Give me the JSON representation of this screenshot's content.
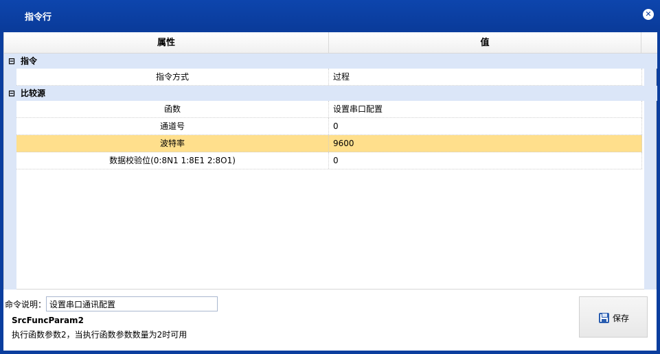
{
  "window": {
    "title": "指令行"
  },
  "grid": {
    "columns": [
      "属性",
      "值"
    ],
    "categories": [
      {
        "toggle": "⊟",
        "name": "指令",
        "rows": [
          {
            "name": "指令方式",
            "value": "过程",
            "selected": false
          }
        ]
      },
      {
        "toggle": "⊟",
        "name": "比较源",
        "rows": [
          {
            "name": "函数",
            "value": "设置串口配置",
            "selected": false
          },
          {
            "name": "通道号",
            "value": "0",
            "selected": false
          },
          {
            "name": "波特率",
            "value": "9600",
            "selected": true
          },
          {
            "name": "数据校验位(0:8N1 1:8E1 2:8O1)",
            "value": "0",
            "selected": false
          }
        ]
      }
    ]
  },
  "footer": {
    "desc_label": "命令说明：",
    "desc_value": "设置串口通讯配置",
    "param_name": "SrcFuncParam2",
    "param_desc": "执行函数参数2，当执行函数参数数量为2时可用",
    "save_label": "保存"
  },
  "colors": {
    "titlebar": "#0b3e9e",
    "category_bg": "#dbe6f8",
    "selected_row": "#ffdf8c"
  },
  "icons": {
    "close": "close-icon",
    "save": "save-icon",
    "collapse": "collapse-icon"
  }
}
